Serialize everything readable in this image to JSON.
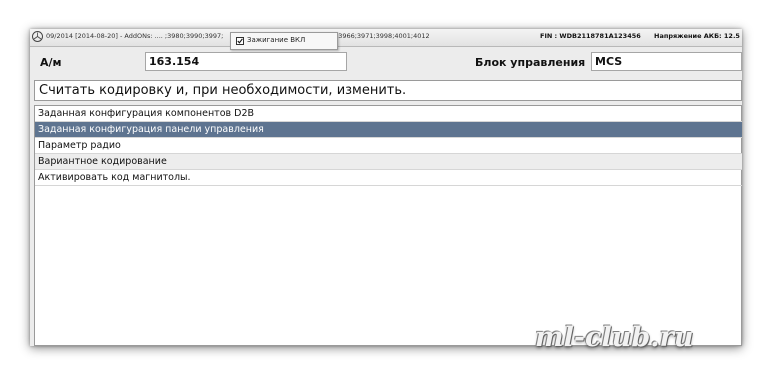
{
  "topbar": {
    "left_text": "09/2014 [2014-08-20] - AddONs: .... ;3980;3990;3997;",
    "mid_text": ";3966;3971;3998;4001;4012",
    "fin": "FIN : WDB2118781A123456",
    "battery": "Напряжение АКБ: 12.5",
    "tooltip": "Зажигание ВКЛ"
  },
  "form": {
    "am_label": "А/м",
    "am_value": "163.154",
    "unit_label": "Блок управления",
    "unit_value": "MCS"
  },
  "command": "Считать кодировку и, при необходимости, изменить.",
  "list": {
    "items": [
      {
        "label": "Заданная конфигурация компонентов D2B"
      },
      {
        "label": "Заданная конфигурация панели управления"
      },
      {
        "label": "Параметр радио"
      },
      {
        "label": "Вариантное кодирование"
      },
      {
        "label": "Активировать код магнитолы."
      }
    ],
    "selected_index": 1
  },
  "watermark": "ml-club.ru",
  "colors": {
    "selection": "#5e7490",
    "window_bg": "#ececec"
  }
}
